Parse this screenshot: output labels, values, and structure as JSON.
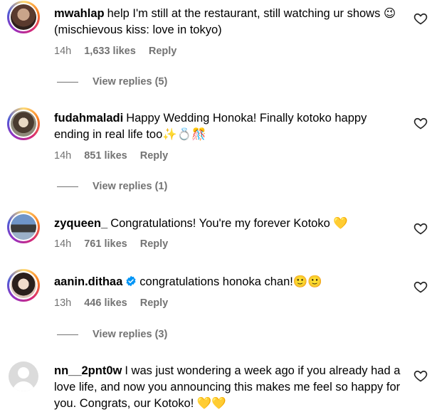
{
  "comments": [
    {
      "username": "mwahlap",
      "text": "help I'm still at the restaurant, still watching ur shows 😉(mischievous kiss: love in tokyo)",
      "time": "14h",
      "likes": "1,633 likes",
      "reply": "Reply",
      "view_replies": "View replies (5)"
    },
    {
      "username": "fudahmaladi",
      "text": "Happy Wedding Honoka! Finally kotoko happy ending in real life too✨💍🎊",
      "time": "14h",
      "likes": "851 likes",
      "reply": "Reply",
      "view_replies": "View replies (1)"
    },
    {
      "username": "zyqueen_",
      "text": "Congratulations! You're my forever Kotoko 💛",
      "time": "14h",
      "likes": "761 likes",
      "reply": "Reply"
    },
    {
      "username": "aanin.dithaa",
      "text": "congratulations honoka chan!🙂🙂",
      "time": "13h",
      "likes": "446 likes",
      "reply": "Reply",
      "view_replies": "View replies (3)"
    },
    {
      "username": "nn__2pnt0w",
      "text": "I was just wondering a week ago if you already had a love life, and now you announcing this makes me feel so happy for you. Congrats, our Kotoko! 💛💛"
    }
  ]
}
